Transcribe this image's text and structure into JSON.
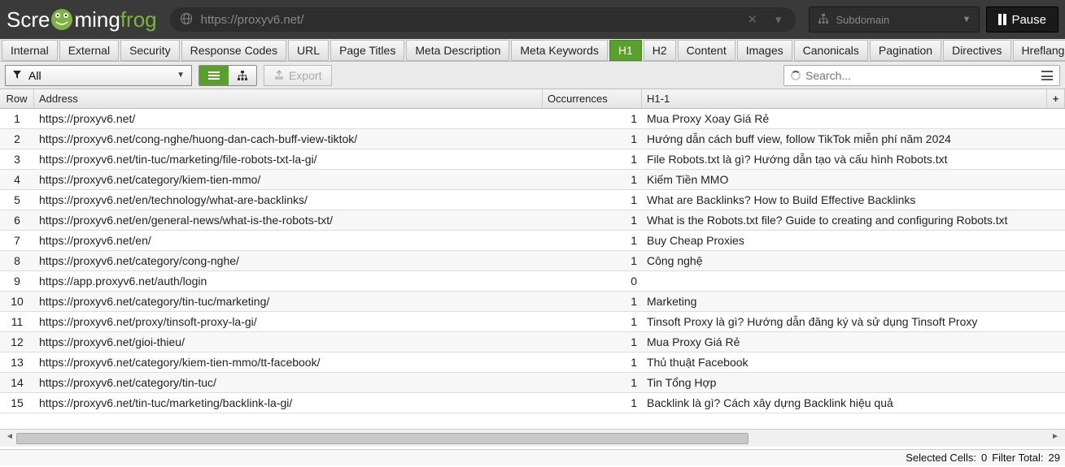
{
  "topbar": {
    "logo_pre": "Scre",
    "logo_mid": "ming",
    "logo_suf": "frog",
    "url": "https://proxyv6.net/",
    "config": "Subdomain",
    "pause": "Pause"
  },
  "tabs": [
    "Internal",
    "External",
    "Security",
    "Response Codes",
    "URL",
    "Page Titles",
    "Meta Description",
    "Meta Keywords",
    "H1",
    "H2",
    "Content",
    "Images",
    "Canonicals",
    "Pagination",
    "Directives",
    "Hreflang"
  ],
  "active_tab_index": 8,
  "filter": {
    "label": "All"
  },
  "export_label": "Export",
  "search_placeholder": "Search...",
  "columns": {
    "row": "Row",
    "address": "Address",
    "occurrences": "Occurrences",
    "h1": "H1-1"
  },
  "rows": [
    {
      "n": 1,
      "address": "https://proxyv6.net/",
      "occ": 1,
      "h1": "Mua Proxy Xoay Giá Rẻ"
    },
    {
      "n": 2,
      "address": "https://proxyv6.net/cong-nghe/huong-dan-cach-buff-view-tiktok/",
      "occ": 1,
      "h1": "Hướng dẫn cách buff view, follow TikTok miễn phí năm 2024"
    },
    {
      "n": 3,
      "address": "https://proxyv6.net/tin-tuc/marketing/file-robots-txt-la-gi/",
      "occ": 1,
      "h1": "File Robots.txt là gì? Hướng dẫn tạo và cấu hình Robots.txt"
    },
    {
      "n": 4,
      "address": "https://proxyv6.net/category/kiem-tien-mmo/",
      "occ": 1,
      "h1": "Kiếm Tiền MMO"
    },
    {
      "n": 5,
      "address": "https://proxyv6.net/en/technology/what-are-backlinks/",
      "occ": 1,
      "h1": "What are Backlinks? How to Build Effective Backlinks"
    },
    {
      "n": 6,
      "address": "https://proxyv6.net/en/general-news/what-is-the-robots-txt/",
      "occ": 1,
      "h1": "What is the Robots.txt file? Guide to creating and configuring Robots.txt"
    },
    {
      "n": 7,
      "address": "https://proxyv6.net/en/",
      "occ": 1,
      "h1": "Buy Cheap Proxies"
    },
    {
      "n": 8,
      "address": "https://proxyv6.net/category/cong-nghe/",
      "occ": 1,
      "h1": "Công nghệ"
    },
    {
      "n": 9,
      "address": "https://app.proxyv6.net/auth/login",
      "occ": 0,
      "h1": ""
    },
    {
      "n": 10,
      "address": "https://proxyv6.net/category/tin-tuc/marketing/",
      "occ": 1,
      "h1": "Marketing"
    },
    {
      "n": 11,
      "address": "https://proxyv6.net/proxy/tinsoft-proxy-la-gi/",
      "occ": 1,
      "h1": "Tinsoft Proxy là gì? Hướng dẫn đăng ký và sử dụng Tinsoft Proxy"
    },
    {
      "n": 12,
      "address": "https://proxyv6.net/gioi-thieu/",
      "occ": 1,
      "h1": "Mua Proxy Giá Rẻ"
    },
    {
      "n": 13,
      "address": "https://proxyv6.net/category/kiem-tien-mmo/tt-facebook/",
      "occ": 1,
      "h1": "Thủ thuật Facebook"
    },
    {
      "n": 14,
      "address": "https://proxyv6.net/category/tin-tuc/",
      "occ": 1,
      "h1": "Tin Tổng Hợp"
    },
    {
      "n": 15,
      "address": "https://proxyv6.net/tin-tuc/marketing/backlink-la-gi/",
      "occ": 1,
      "h1": "Backlink là gì? Cách xây dựng Backlink hiệu quả"
    }
  ],
  "status": {
    "selected_label": "Selected Cells:",
    "selected_value": "0",
    "filter_label": "Filter Total:",
    "filter_value": "29"
  }
}
